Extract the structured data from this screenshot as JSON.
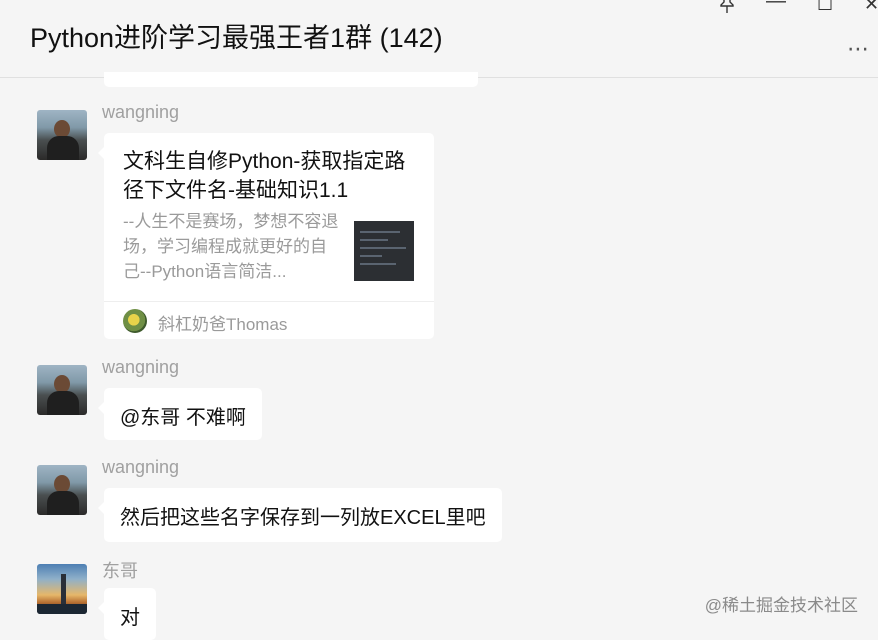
{
  "window": {
    "title": "Python进阶学习最强王者1群 (142)",
    "pin_icon": "pin-icon",
    "minimize_symbol": "—",
    "maximize_symbol": "☐",
    "close_symbol": "✕",
    "more_symbol": "⋯"
  },
  "messages": [
    {
      "sender": "wangning",
      "type": "article_card",
      "article": {
        "title": "文科生自修Python-获取指定路径下文件名-基础知识1.1",
        "description": "--人生不是赛场，梦想不容退场，学习编程成就更好的自己--Python语言简洁...",
        "source": "斜杠奶爸Thomas"
      }
    },
    {
      "sender": "wangning",
      "type": "text",
      "text": "@东哥 不难啊"
    },
    {
      "sender": "wangning",
      "type": "text",
      "text": "然后把这些名字保存到一列放EXCEL里吧"
    },
    {
      "sender": "东哥",
      "type": "text",
      "text": "对"
    }
  ],
  "watermark": "@稀土掘金技术社区",
  "colors": {
    "background": "#f5f5f5",
    "bubble": "#ffffff",
    "sender_name": "#a0a0a0"
  }
}
